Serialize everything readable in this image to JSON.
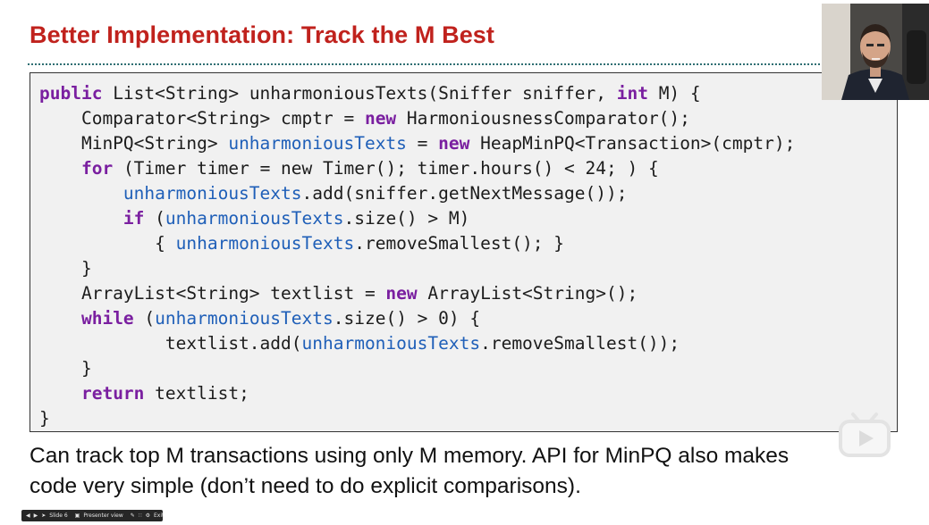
{
  "slide": {
    "title": "Better Implementation: Track the M Best",
    "code_lines": [
      [
        {
          "t": "public",
          "c": "kw"
        },
        {
          "t": " List<String> unharmoniousTexts(Sniffer sniffer, "
        },
        {
          "t": "int",
          "c": "kw"
        },
        {
          "t": " M) {"
        }
      ],
      [
        {
          "t": "    Comparator<String> cmptr = "
        },
        {
          "t": "new",
          "c": "kw"
        },
        {
          "t": " HarmoniousnessComparator();"
        }
      ],
      [
        {
          "t": "    MinPQ<String> "
        },
        {
          "t": "unharmoniousTexts",
          "c": "var"
        },
        {
          "t": " = "
        },
        {
          "t": "new",
          "c": "kw"
        },
        {
          "t": " HeapMinPQ<Transaction>(cmptr);"
        }
      ],
      [
        {
          "t": "    "
        },
        {
          "t": "for",
          "c": "kw"
        },
        {
          "t": " (Timer timer = new Timer(); timer.hours() < 24; ) {"
        }
      ],
      [
        {
          "t": "        "
        },
        {
          "t": "unharmoniousTexts",
          "c": "var"
        },
        {
          "t": ".add(sniffer.getNextMessage());"
        }
      ],
      [
        {
          "t": "        "
        },
        {
          "t": "if",
          "c": "kw"
        },
        {
          "t": " ("
        },
        {
          "t": "unharmoniousTexts",
          "c": "var"
        },
        {
          "t": ".size() > M)"
        }
      ],
      [
        {
          "t": "           { "
        },
        {
          "t": "unharmoniousTexts",
          "c": "var"
        },
        {
          "t": ".removeSmallest(); }"
        }
      ],
      [
        {
          "t": "    }"
        }
      ],
      [
        {
          "t": "    ArrayList<String> textlist = "
        },
        {
          "t": "new",
          "c": "kw"
        },
        {
          "t": " ArrayList<String>();"
        }
      ],
      [
        {
          "t": "    "
        },
        {
          "t": "while",
          "c": "kw"
        },
        {
          "t": " ("
        },
        {
          "t": "unharmoniousTexts",
          "c": "var"
        },
        {
          "t": ".size() > 0) {"
        }
      ],
      [
        {
          "t": "            textlist.add("
        },
        {
          "t": "unharmoniousTexts",
          "c": "var"
        },
        {
          "t": ".removeSmallest());"
        }
      ],
      [
        {
          "t": "    }"
        }
      ],
      [
        {
          "t": "    "
        },
        {
          "t": "return",
          "c": "kw"
        },
        {
          "t": " textlist;"
        }
      ],
      [
        {
          "t": "}"
        }
      ]
    ],
    "caption_lines": [
      "Can track top M transactions using only M memory. API for MinPQ also makes",
      "code very simple (don’t need to do explicit comparisons)."
    ]
  },
  "presenter_toolbar": {
    "slide_label": "Slide 6",
    "presenter_view_label": "Presenter view",
    "exit_label": "Exit"
  },
  "colors": {
    "title": "#c0221d",
    "keyword": "#7a1fa0",
    "variable": "#1f5fb8",
    "code_background": "#f1f1f1",
    "rule": "#2f6f73"
  },
  "icons": [
    "prev-icon",
    "play-icon",
    "next-icon",
    "monitor-icon",
    "pen-icon",
    "grid-icon",
    "gear-icon",
    "video-play-icon"
  ]
}
